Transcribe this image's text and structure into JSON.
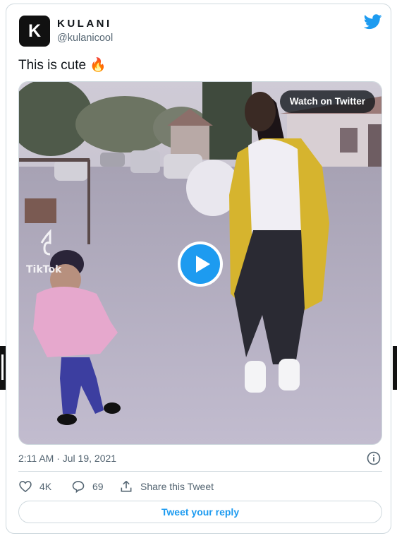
{
  "author": {
    "display_name": "KULANI",
    "handle": "@kulanicool",
    "avatar_letter": "K"
  },
  "tweet": {
    "text": "This is cute 🔥",
    "timestamp": "2:11 AM · Jul 19, 2021"
  },
  "media": {
    "watch_label": "Watch on Twitter",
    "watermark": "TikTok",
    "kind": "video"
  },
  "actions": {
    "likes": "4K",
    "replies": "69",
    "share_label": "Share this Tweet"
  },
  "reply_button_label": "Tweet your reply",
  "colors": {
    "accent": "#1d9bf0",
    "muted_text": "#536471",
    "border": "#cfd9de"
  },
  "icons": [
    "twitter-bird-icon",
    "info-icon",
    "heart-icon",
    "reply-bubble-icon",
    "share-icon",
    "play-icon"
  ]
}
